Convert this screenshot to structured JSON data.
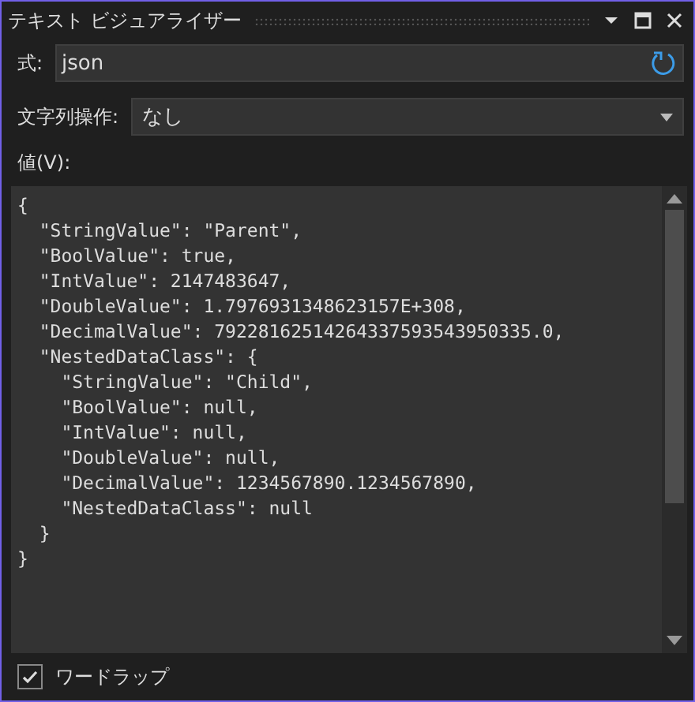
{
  "window": {
    "title": "テキスト ビジュアライザー"
  },
  "expression": {
    "label": "式:",
    "value": "json"
  },
  "string_operation": {
    "label": "文字列操作:",
    "value": "なし"
  },
  "value_label": "値(V):",
  "value_lines": [
    "{",
    "  \"StringValue\": \"Parent\",",
    "  \"BoolValue\": true,",
    "  \"IntValue\": 2147483647,",
    "  \"DoubleValue\": 1.7976931348623157E+308,",
    "  \"DecimalValue\": 79228162514264337593543950335.0,",
    "  \"NestedDataClass\": {",
    "    \"StringValue\": \"Child\",",
    "    \"BoolValue\": null,",
    "    \"IntValue\": null,",
    "    \"DoubleValue\": null,",
    "    \"DecimalValue\": 1234567890.1234567890,",
    "    \"NestedDataClass\": null",
    "  }",
    "}"
  ],
  "word_wrap": {
    "label": "ワードラップ",
    "checked": true
  }
}
